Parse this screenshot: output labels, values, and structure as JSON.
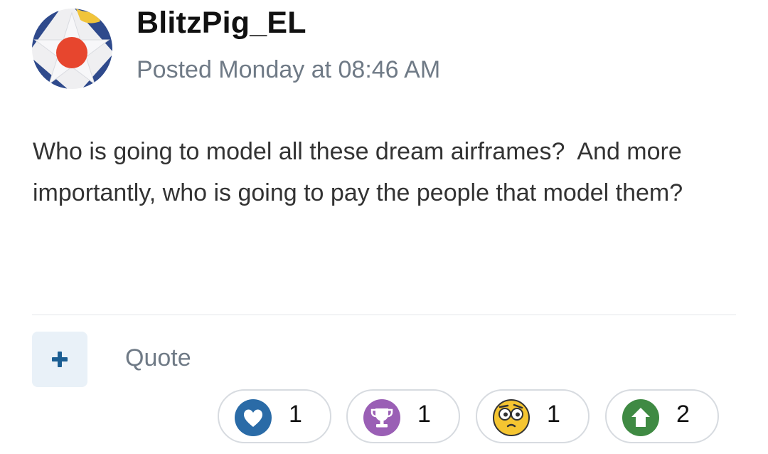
{
  "post": {
    "author": "BlitzPig_EL",
    "posted": "Posted Monday at 08:46 AM",
    "body": "Who is going to model all these dream airframes?  And more importantly, who is going to pay the people that model them?"
  },
  "actions": {
    "multiquote_symbol": "+",
    "quote_label": "Quote"
  },
  "reactions": [
    {
      "icon": "heart-icon",
      "count": "1",
      "color": "#2a6ba7"
    },
    {
      "icon": "trophy-icon",
      "count": "1",
      "color": "#9a5fb5"
    },
    {
      "icon": "confused-face-icon",
      "count": "1",
      "color": "#f5c531"
    },
    {
      "icon": "upvote-arrow-icon",
      "count": "2",
      "color": "#3f8a43"
    }
  ],
  "colors": {
    "meta_text": "#6f7a86",
    "body_text": "#333333",
    "accent": "#1b5e93"
  }
}
